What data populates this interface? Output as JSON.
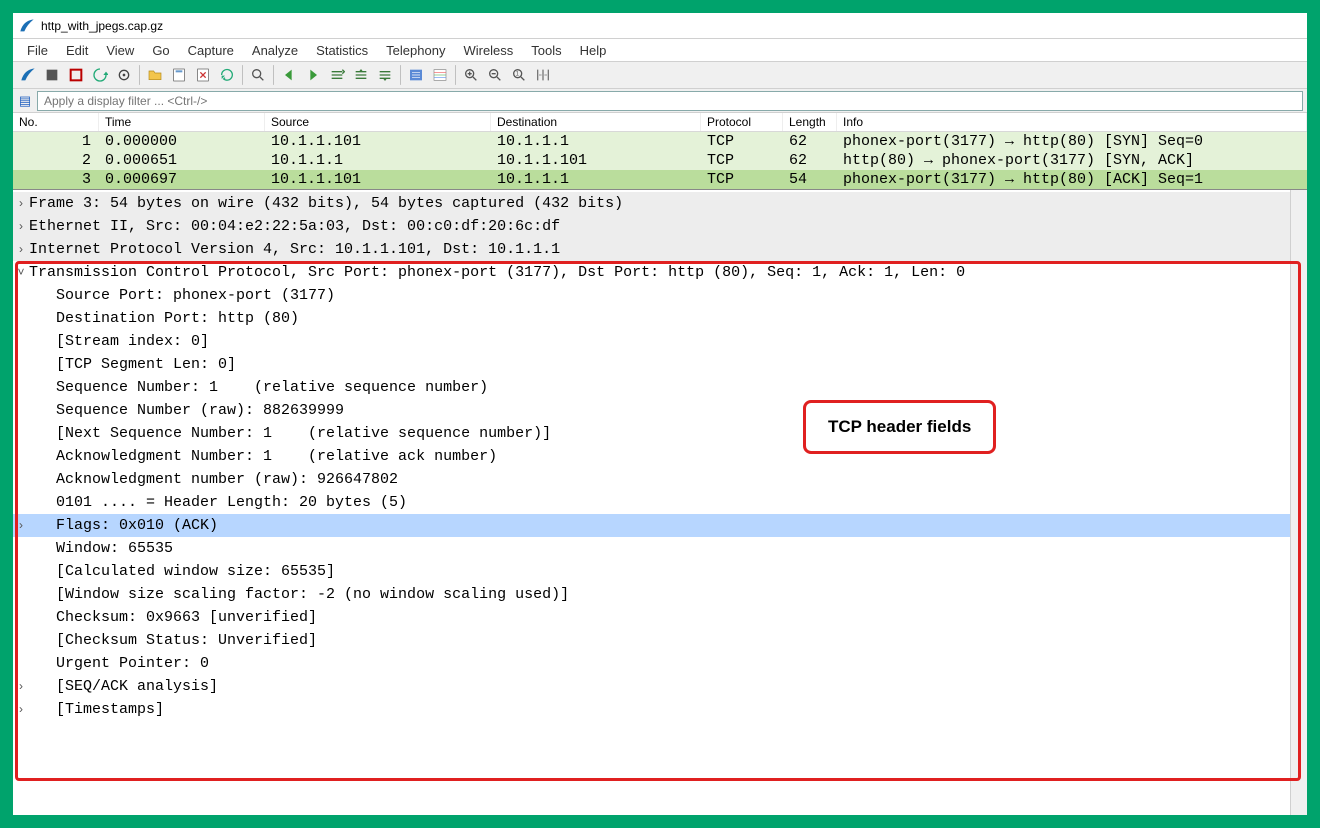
{
  "title": "http_with_jpegs.cap.gz",
  "menus": [
    "File",
    "Edit",
    "View",
    "Go",
    "Capture",
    "Analyze",
    "Statistics",
    "Telephony",
    "Wireless",
    "Tools",
    "Help"
  ],
  "toolbar_icons": [
    "fin",
    "start",
    "stop",
    "restart",
    "options",
    "sep",
    "open",
    "save",
    "close",
    "reload",
    "sep",
    "find",
    "sep",
    "back",
    "forward",
    "goto",
    "gotop",
    "godown",
    "sep",
    "autoscroll",
    "colorize",
    "sep",
    "zoom-in",
    "zoom-out",
    "zoom-reset",
    "resize-cols"
  ],
  "filter_placeholder": "Apply a display filter ... <Ctrl-/>",
  "columns": [
    "No.",
    "Time",
    "Source",
    "Destination",
    "Protocol",
    "Length",
    "Info"
  ],
  "packets": [
    {
      "no": "1",
      "time": "0.000000",
      "src": "10.1.1.101",
      "dst": "10.1.1.1",
      "proto": "TCP",
      "len": "62",
      "info": "phonex-port(3177) → http(80) [SYN] Seq=0",
      "sel": false
    },
    {
      "no": "2",
      "time": "0.000651",
      "src": "10.1.1.1",
      "dst": "10.1.1.101",
      "proto": "TCP",
      "len": "62",
      "info": "http(80) → phonex-port(3177) [SYN, ACK]",
      "sel": false
    },
    {
      "no": "3",
      "time": "0.000697",
      "src": "10.1.1.101",
      "dst": "10.1.1.1",
      "proto": "TCP",
      "len": "54",
      "info": "phonex-port(3177) → http(80) [ACK] Seq=1",
      "sel": true
    }
  ],
  "detail_top": [
    {
      "tw": "›",
      "indent": 0,
      "text": "Frame 3: 54 bytes on wire (432 bits), 54 bytes captured (432 bits)"
    },
    {
      "tw": "›",
      "indent": 0,
      "text": "Ethernet II, Src: 00:04:e2:22:5a:03, Dst: 00:c0:df:20:6c:df"
    },
    {
      "tw": "›",
      "indent": 0,
      "text": "Internet Protocol Version 4, Src: 10.1.1.101, Dst: 10.1.1.1"
    }
  ],
  "tcp_header": {
    "tw": "˅",
    "indent": 0,
    "text": "Transmission Control Protocol, Src Port: phonex-port (3177), Dst Port: http (80), Seq: 1, Ack: 1, Len: 0"
  },
  "tcp_fields": [
    {
      "tw": "",
      "indent": 1,
      "text": "Source Port: phonex-port (3177)"
    },
    {
      "tw": "",
      "indent": 1,
      "text": "Destination Port: http (80)"
    },
    {
      "tw": "",
      "indent": 1,
      "text": "[Stream index: 0]"
    },
    {
      "tw": "",
      "indent": 1,
      "text": "[TCP Segment Len: 0]"
    },
    {
      "tw": "",
      "indent": 1,
      "text": "Sequence Number: 1    (relative sequence number)"
    },
    {
      "tw": "",
      "indent": 1,
      "text": "Sequence Number (raw): 882639999"
    },
    {
      "tw": "",
      "indent": 1,
      "text": "[Next Sequence Number: 1    (relative sequence number)]"
    },
    {
      "tw": "",
      "indent": 1,
      "text": "Acknowledgment Number: 1    (relative ack number)"
    },
    {
      "tw": "",
      "indent": 1,
      "text": "Acknowledgment number (raw): 926647802"
    },
    {
      "tw": "",
      "indent": 1,
      "text": "0101 .... = Header Length: 20 bytes (5)"
    },
    {
      "tw": "›",
      "indent": 1,
      "text": "Flags: 0x010 (ACK)",
      "sel": true
    },
    {
      "tw": "",
      "indent": 1,
      "text": "Window: 65535"
    },
    {
      "tw": "",
      "indent": 1,
      "text": "[Calculated window size: 65535]"
    },
    {
      "tw": "",
      "indent": 1,
      "text": "[Window size scaling factor: -2 (no window scaling used)]"
    },
    {
      "tw": "",
      "indent": 1,
      "text": "Checksum: 0x9663 [unverified]"
    },
    {
      "tw": "",
      "indent": 1,
      "text": "[Checksum Status: Unverified]"
    },
    {
      "tw": "",
      "indent": 1,
      "text": "Urgent Pointer: 0"
    },
    {
      "tw": "›",
      "indent": 1,
      "text": "[SEQ/ACK analysis]"
    },
    {
      "tw": "›",
      "indent": 1,
      "text": "[Timestamps]"
    }
  ],
  "callout_text": "TCP header fields"
}
